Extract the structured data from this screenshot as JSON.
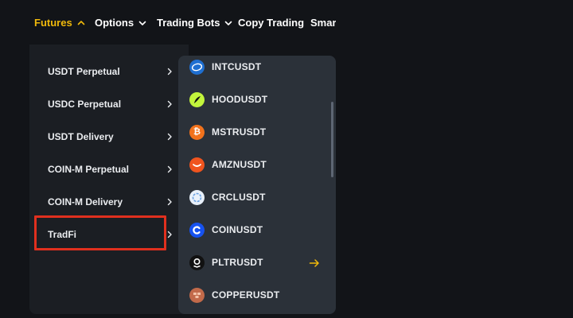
{
  "nav": {
    "items": [
      {
        "label": "Futures",
        "active": true
      },
      {
        "label": "Options",
        "active": false
      },
      {
        "label": "Trading Bots",
        "active": false
      },
      {
        "label": "Copy Trading",
        "active": false
      },
      {
        "label": "Smart",
        "active": false
      }
    ],
    "chevron_icon": "chevron-down-icon",
    "active_icon": "chevron-up-icon"
  },
  "futures_menu": {
    "items": [
      {
        "label": "USDT Perpetual"
      },
      {
        "label": "USDC Perpetual"
      },
      {
        "label": "USDT Delivery"
      },
      {
        "label": "COIN-M Perpetual"
      },
      {
        "label": "COIN-M Delivery"
      },
      {
        "label": "TradFi",
        "highlighted": true
      }
    ],
    "row_icon": "chevron-right-icon"
  },
  "tradfi_list": {
    "items": [
      {
        "symbol": "INTCUSDT",
        "icon": "intel-logo-icon",
        "color": "#1f6fd1"
      },
      {
        "symbol": "HOODUSDT",
        "icon": "robinhood-feather-icon",
        "color": "#c3f53c"
      },
      {
        "symbol": "MSTRUSDT",
        "icon": "bitcoin-icon",
        "color": "#f2721c"
      },
      {
        "symbol": "AMZNUSDT",
        "icon": "amazon-smile-icon",
        "color": "#f0541e"
      },
      {
        "symbol": "CRCLUSDT",
        "icon": "circle-logo-icon",
        "color": "#e8f0fa"
      },
      {
        "symbol": "COINUSDT",
        "icon": "coinbase-c-icon",
        "color": "#1652f0"
      },
      {
        "symbol": "PLTRUSDT",
        "icon": "palantir-logo-icon",
        "color": "#111111",
        "hover": true
      },
      {
        "symbol": "COPPERUSDT",
        "icon": "copper-icon",
        "color": "#c26a4a"
      }
    ],
    "hover_icon": "arrow-right-icon"
  },
  "colors": {
    "accent": "#f0b90b",
    "highlight_border": "#e0301e",
    "background": "#121418",
    "left_panel": "#1b1e23",
    "right_panel": "#2b3139"
  }
}
